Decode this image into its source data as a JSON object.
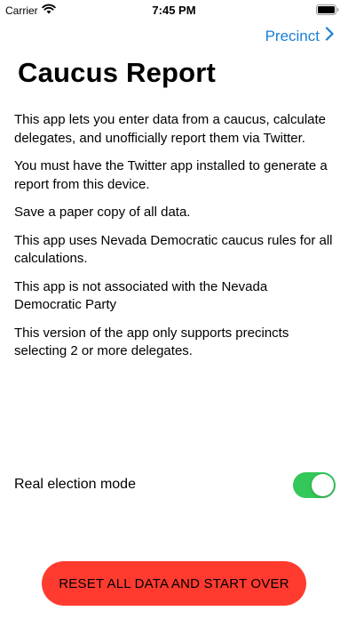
{
  "status_bar": {
    "carrier": "Carrier",
    "time": "7:45 PM",
    "icons": [
      "wifi-icon",
      "battery-icon"
    ]
  },
  "nav": {
    "next_label": "Precinct",
    "next_icon": "chevron-right-icon"
  },
  "title": "Caucus Report",
  "paragraphs": [
    "This app lets you enter data from a caucus, calculate delegates, and unofficially report them via Twitter.",
    "You must have the Twitter app installed to generate a report from this device.",
    "Save a paper copy of all data.",
    "This app uses Nevada Democratic caucus rules for all calculations.",
    "This app is not associated with the Nevada Democratic Party",
    "This version of the app only supports precincts selecting 2 or more delegates."
  ],
  "toggle": {
    "label": "Real election mode",
    "on": true
  },
  "reset_button": {
    "label": "RESET ALL DATA AND START OVER"
  },
  "colors": {
    "accent": "#1a7fd4",
    "toggle_on": "#34c759",
    "reset_button": "#ff3b30"
  }
}
